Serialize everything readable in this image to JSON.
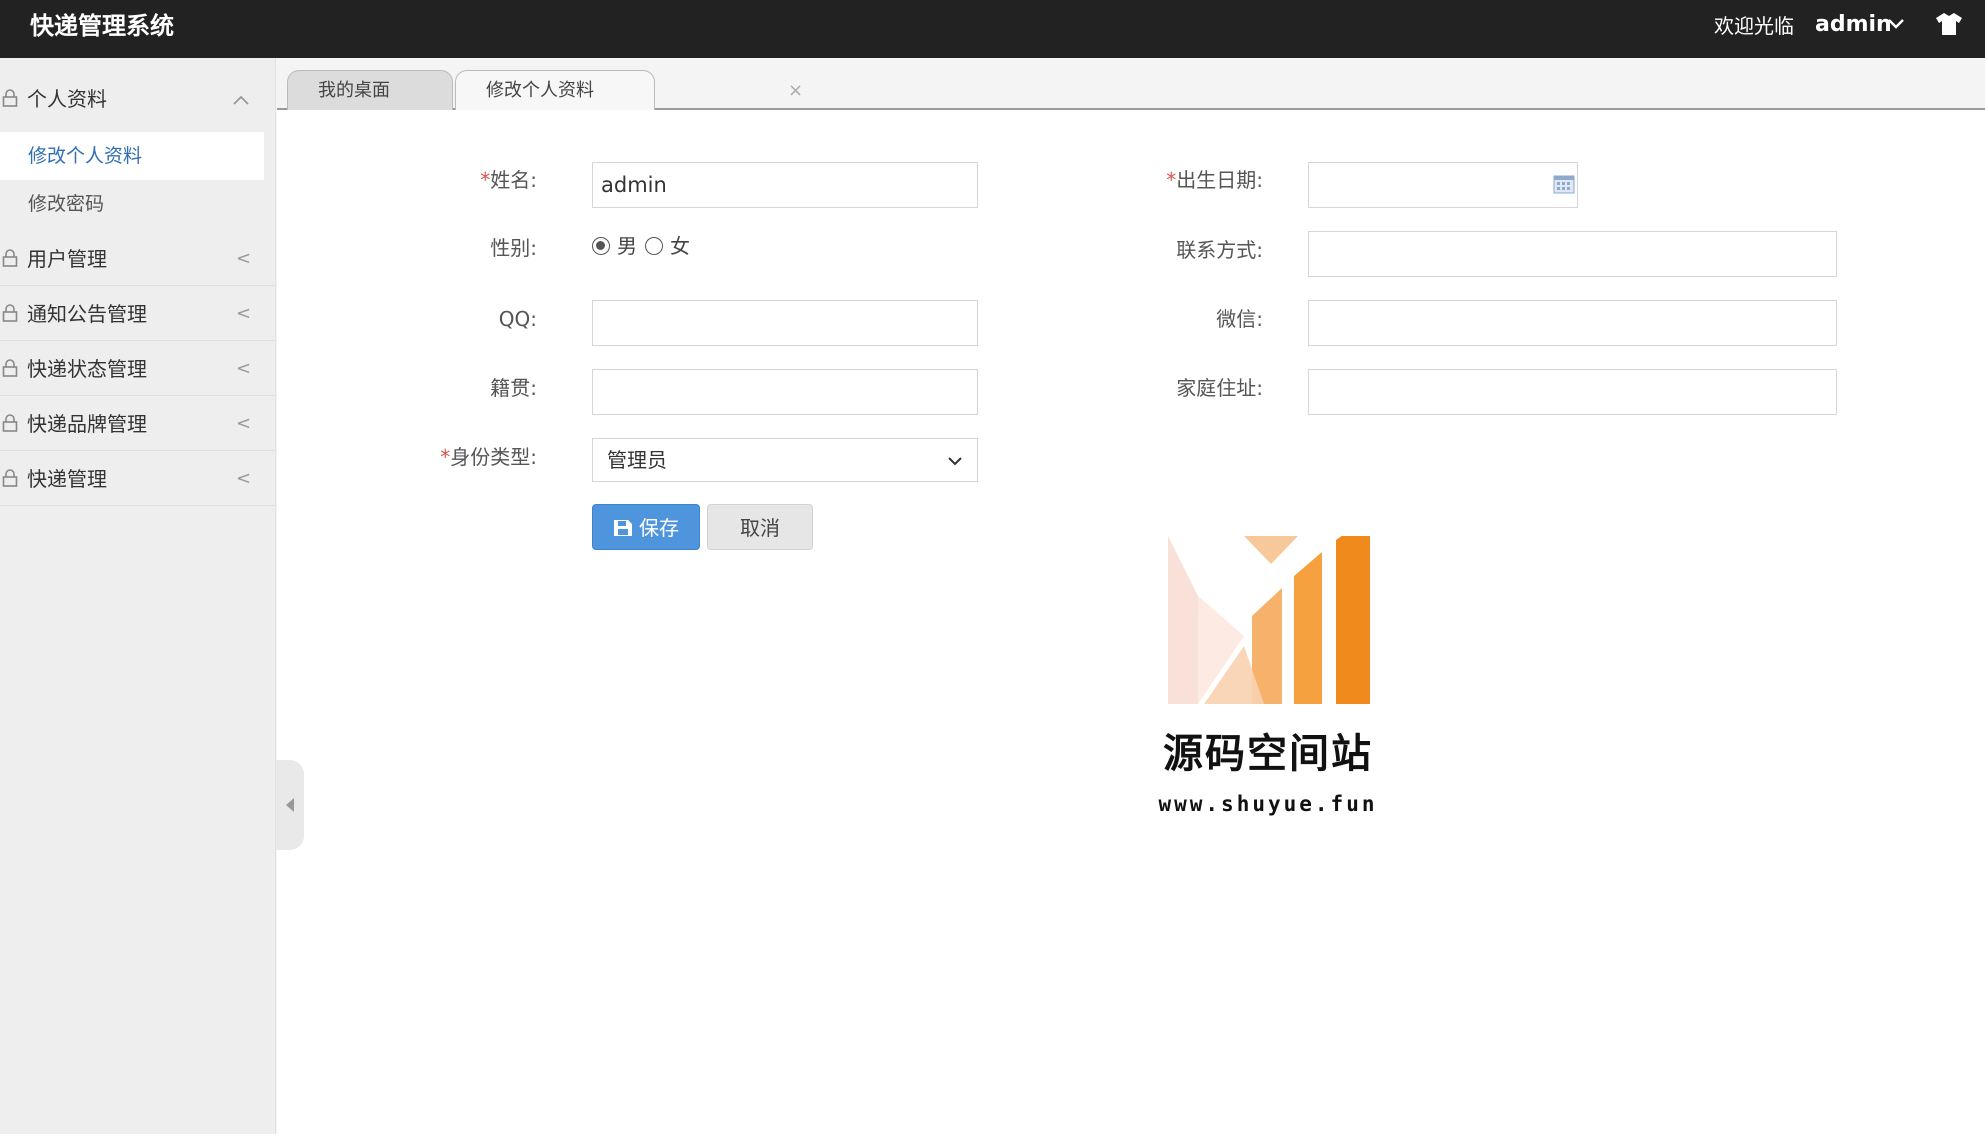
{
  "header": {
    "app_title": "快递管理系统",
    "welcome_text": "欢迎光临",
    "username": "admin",
    "icons": [
      "chevron-down-icon",
      "shirt-icon"
    ]
  },
  "sidebar": {
    "groups": [
      {
        "label": "个人资料",
        "expanded": true,
        "children": [
          {
            "label": "修改个人资料",
            "active": true
          },
          {
            "label": "修改密码",
            "active": false
          }
        ]
      },
      {
        "label": "用户管理",
        "expanded": false,
        "arrow": "<"
      },
      {
        "label": "通知公告管理",
        "expanded": false,
        "arrow": "<"
      },
      {
        "label": "快递状态管理",
        "expanded": false,
        "arrow": "<"
      },
      {
        "label": "快递品牌管理",
        "expanded": false,
        "arrow": "<"
      },
      {
        "label": "快递管理",
        "expanded": false,
        "arrow": "<"
      }
    ]
  },
  "tabs": [
    {
      "label": "我的桌面",
      "active": false
    },
    {
      "label": "修改个人资料",
      "active": true,
      "close": "×"
    }
  ],
  "form": {
    "required_mark": "*",
    "name": {
      "label": "姓名:",
      "value": "admin"
    },
    "birthday": {
      "label": "出生日期:",
      "value": ""
    },
    "gender": {
      "label": "性别:",
      "options": [
        "男",
        "女"
      ],
      "selected": "男"
    },
    "contact": {
      "label": "联系方式:",
      "value": ""
    },
    "qq": {
      "label": "QQ:",
      "value": ""
    },
    "wechat": {
      "label": "微信:",
      "value": ""
    },
    "native_place": {
      "label": "籍贯:",
      "value": ""
    },
    "address": {
      "label": "家庭住址:",
      "value": ""
    },
    "identity": {
      "label": "身份类型:",
      "selected": "管理员"
    },
    "save_label": "保存",
    "cancel_label": "取消"
  },
  "watermark": {
    "title": "源码空间站",
    "url": "www.shuyue.fun"
  },
  "colors": {
    "topbar": "#222222",
    "accent_blue": "#4e95de",
    "active_link": "#2f6fb4",
    "required": "#d9534f",
    "logo_orange": "#f18a1c"
  }
}
